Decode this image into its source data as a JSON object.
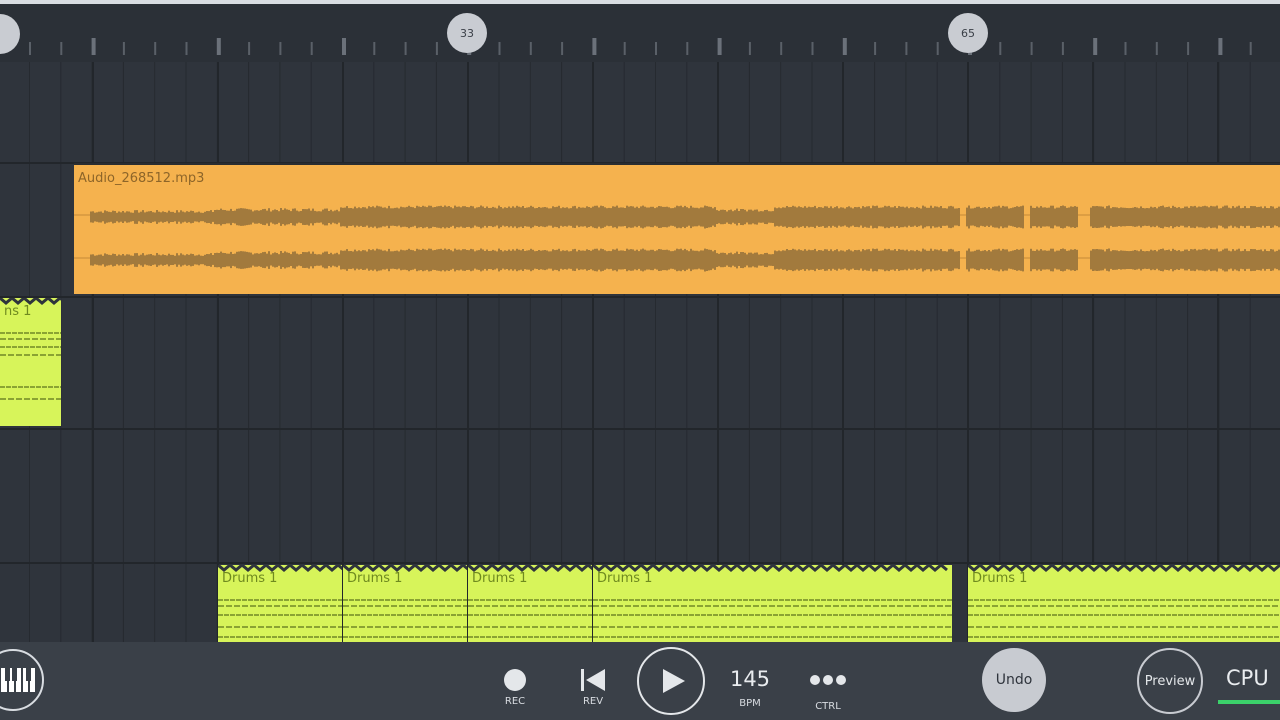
{
  "ruler": {
    "markers": [
      {
        "label": "33"
      },
      {
        "label": "65"
      }
    ]
  },
  "clips": {
    "audio": {
      "name": "Audio_268512.mp3"
    },
    "patterns": [
      {
        "name": "ns 1"
      },
      {
        "name": "Drums 1"
      },
      {
        "name": "Drums 1"
      },
      {
        "name": "Drums 1"
      },
      {
        "name": "Drums 1"
      },
      {
        "name": "Drums 1"
      }
    ]
  },
  "toolbar": {
    "rec_label": "REC",
    "rev_label": "REV",
    "bpm_value": "145",
    "bpm_label": "BPM",
    "ctrl_label": "CTRL",
    "undo_label": "Undo",
    "preview_label": "Preview",
    "cpu_label": "CPU"
  },
  "colors": {
    "background": "#2f343c",
    "audio_clip": "#f5b24e",
    "pattern_clip": "#d7f45a",
    "cpu_meter": "#3bd16a"
  },
  "icons": [
    "piano-icon",
    "record-icon",
    "rewind-icon",
    "play-icon",
    "more-icon"
  ]
}
